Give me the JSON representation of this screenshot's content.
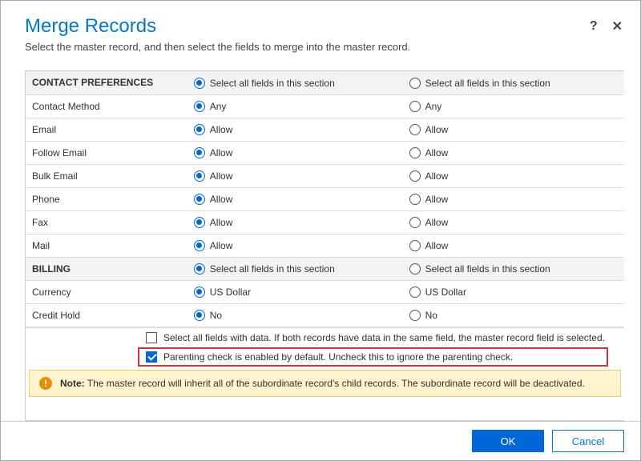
{
  "header": {
    "title": "Merge Records",
    "subtitle": "Select the master record, and then select the fields to merge into the master record.",
    "help_label": "?",
    "close_label": "✕"
  },
  "section_select_label": "Select all fields in this section",
  "sections": [
    {
      "name": "CONTACT PREFERENCES",
      "header_a_selected": true,
      "header_b_selected": false,
      "rows": [
        {
          "label": "Contact Method",
          "a": "Any",
          "b": "Any",
          "sel": "a"
        },
        {
          "label": "Email",
          "a": "Allow",
          "b": "Allow",
          "sel": "a"
        },
        {
          "label": "Follow Email",
          "a": "Allow",
          "b": "Allow",
          "sel": "a"
        },
        {
          "label": "Bulk Email",
          "a": "Allow",
          "b": "Allow",
          "sel": "a"
        },
        {
          "label": "Phone",
          "a": "Allow",
          "b": "Allow",
          "sel": "a"
        },
        {
          "label": "Fax",
          "a": "Allow",
          "b": "Allow",
          "sel": "a"
        },
        {
          "label": "Mail",
          "a": "Allow",
          "b": "Allow",
          "sel": "a"
        }
      ]
    },
    {
      "name": "BILLING",
      "header_a_selected": true,
      "header_b_selected": false,
      "rows": [
        {
          "label": "Currency",
          "a": "US Dollar",
          "b": "US Dollar",
          "sel": "a"
        },
        {
          "label": "Credit Hold",
          "a": "No",
          "b": "No",
          "sel": "a"
        }
      ]
    }
  ],
  "options": {
    "select_all_with_data": {
      "checked": false,
      "label": "Select all fields with data. If both records have data in the same field, the master record field is selected."
    },
    "parenting_check": {
      "checked": true,
      "label": "Parenting check is enabled by default. Uncheck this to ignore the parenting check."
    }
  },
  "note": {
    "prefix": "Note:",
    "text": "The master record will inherit all of the subordinate record's child records. The subordinate record will be deactivated."
  },
  "footer": {
    "ok": "OK",
    "cancel": "Cancel"
  }
}
